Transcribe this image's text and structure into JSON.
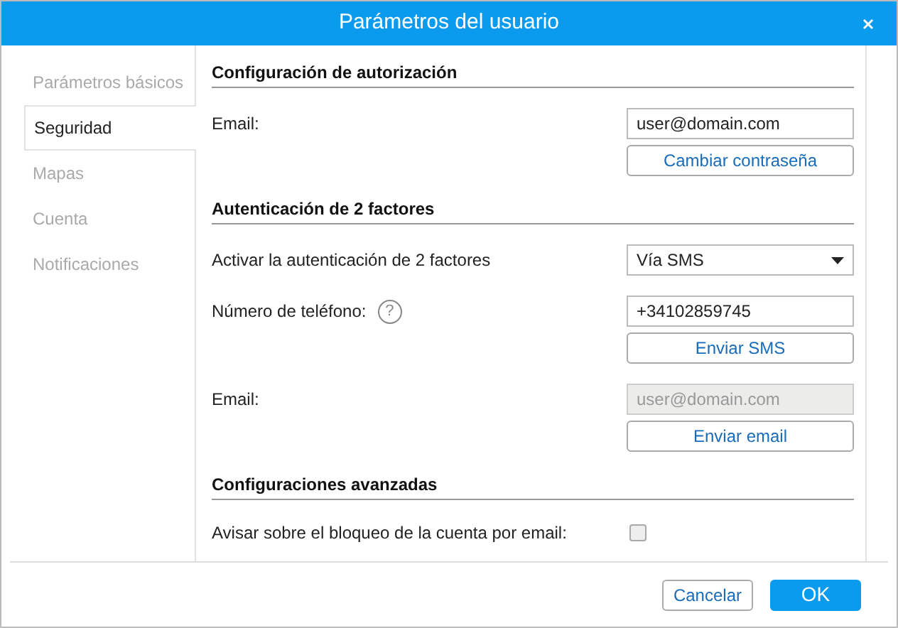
{
  "window": {
    "title": "Parámetros del usuario"
  },
  "sidebar": {
    "items": [
      {
        "label": "Parámetros básicos",
        "selected": false
      },
      {
        "label": "Seguridad",
        "selected": true
      },
      {
        "label": "Mapas",
        "selected": false
      },
      {
        "label": "Cuenta",
        "selected": false
      },
      {
        "label": "Notificaciones",
        "selected": false
      }
    ]
  },
  "sections": [
    {
      "title": "Configuración de autorización",
      "rows": [
        {
          "kind": "field",
          "label": "Email:",
          "value": "user@domain.com",
          "disabled": false,
          "button": "Cambiar contraseña"
        }
      ]
    },
    {
      "title": "Autenticación de 2 factores",
      "rows": [
        {
          "kind": "select",
          "label": "Activar la autenticación de 2 factores",
          "value": "Vía SMS"
        },
        {
          "kind": "field",
          "label": "Número de teléfono:",
          "help": "?",
          "value": "+34102859745",
          "disabled": false,
          "button": "Enviar SMS"
        },
        {
          "kind": "field",
          "label": "Email:",
          "value": "user@domain.com",
          "disabled": true,
          "button": "Enviar email"
        }
      ]
    },
    {
      "title": "Configuraciones avanzadas",
      "rows": [
        {
          "kind": "checkbox",
          "label": "Avisar sobre el bloqueo de la cuenta por email:",
          "checked": false
        }
      ]
    }
  ],
  "footer": {
    "buttons": [
      {
        "label": "Cancelar",
        "kind": "secondary"
      },
      {
        "label": "OK",
        "kind": "primary"
      }
    ]
  }
}
